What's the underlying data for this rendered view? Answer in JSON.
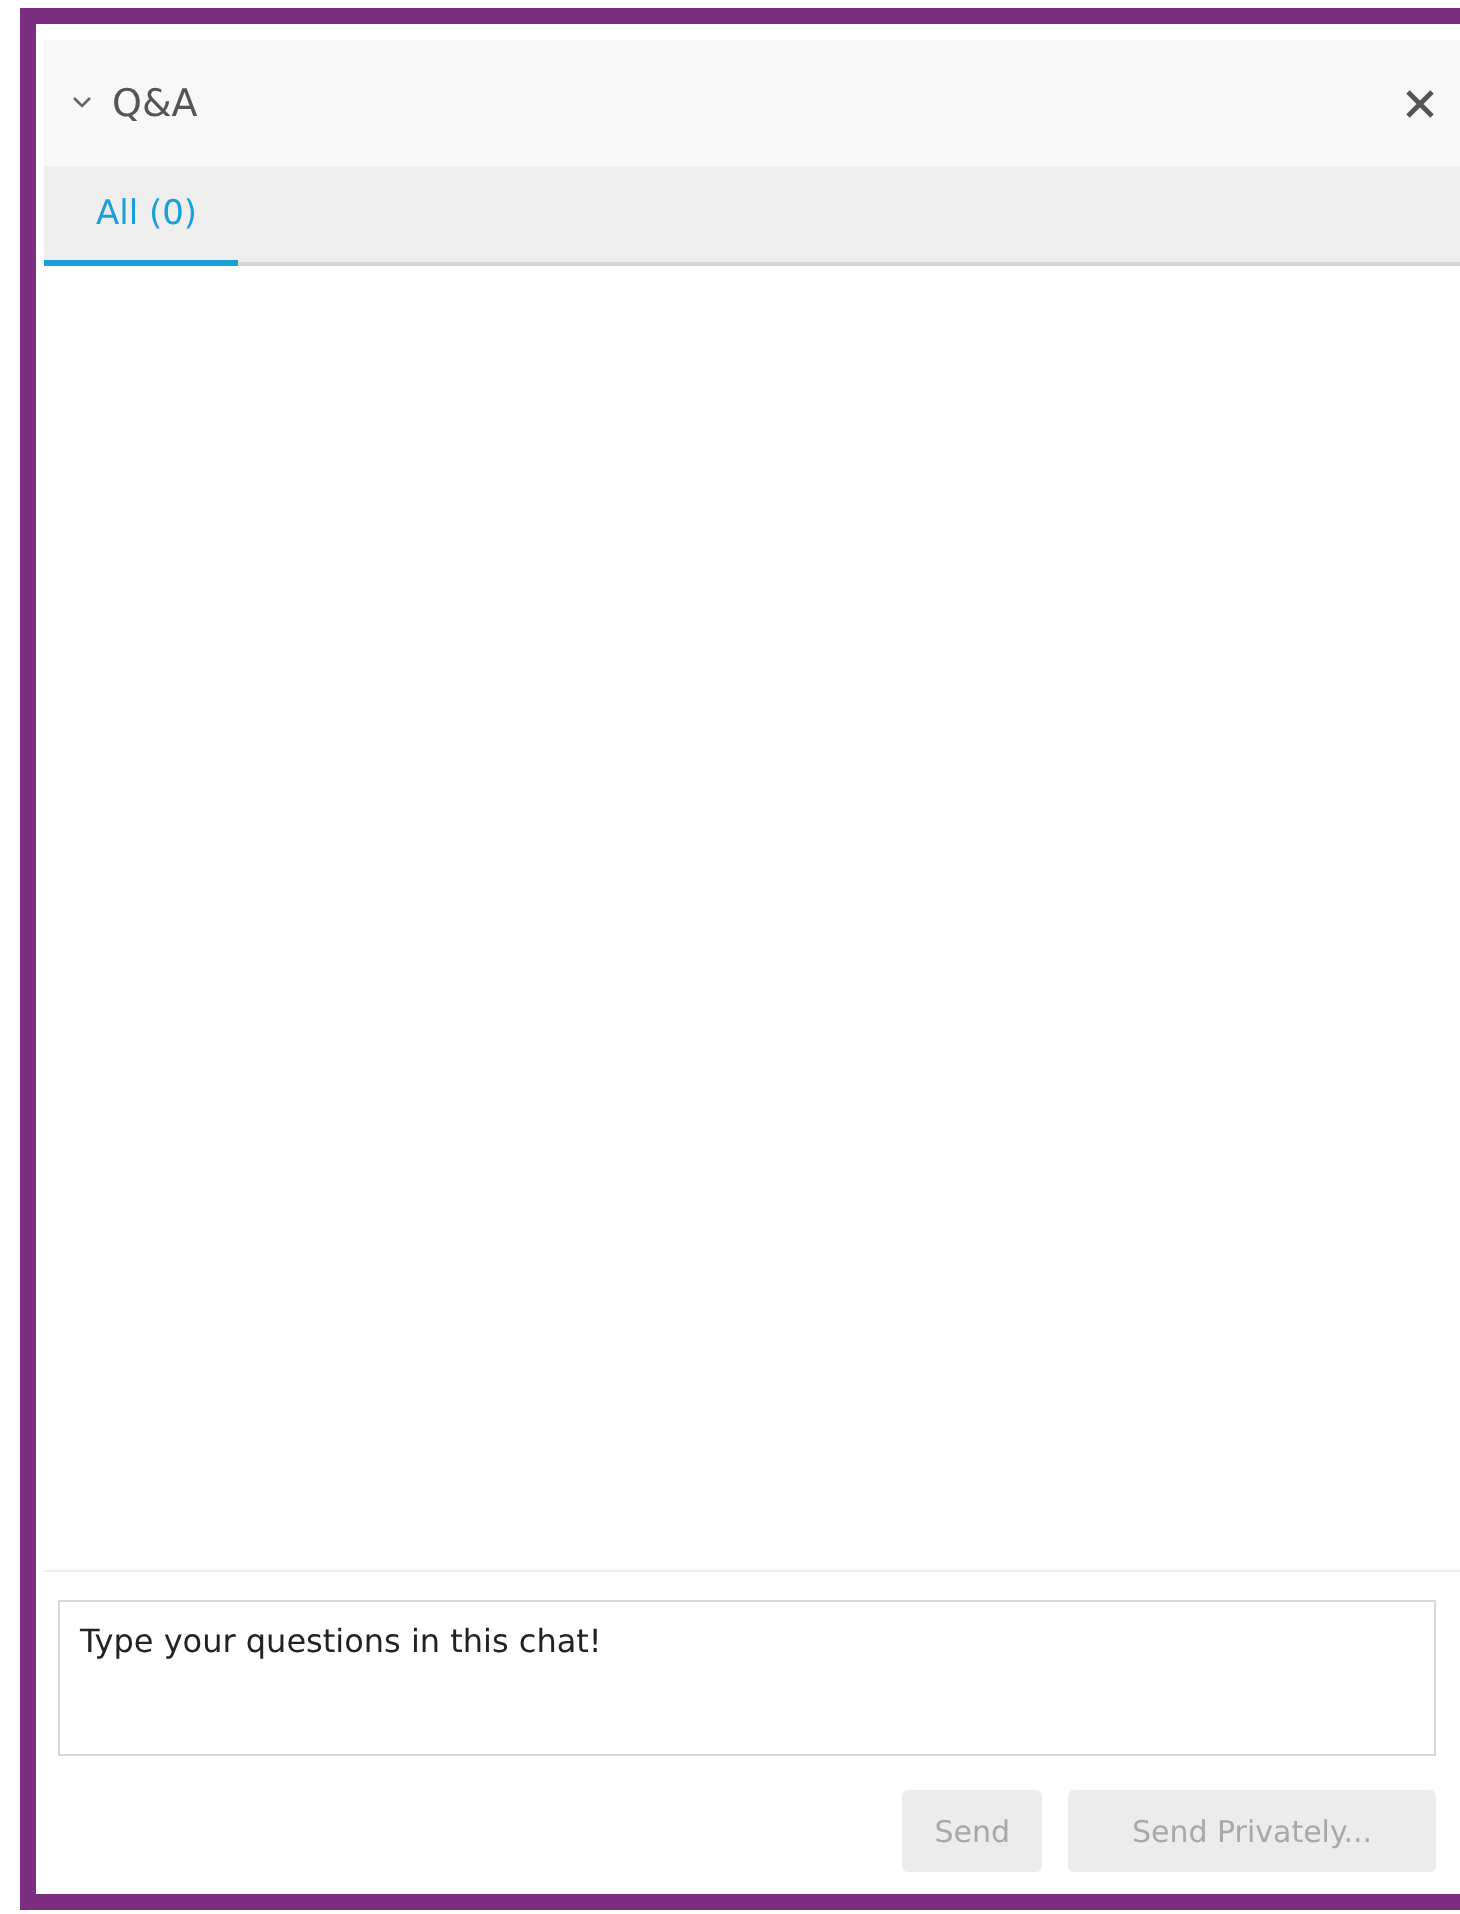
{
  "panel": {
    "title": "Q&A",
    "expanded": true
  },
  "tabs": [
    {
      "label": "All (0)",
      "selected": true
    }
  ],
  "composer": {
    "value": "Type your questions in this chat!"
  },
  "buttons": [
    {
      "label": "Send",
      "disabled": true
    },
    {
      "label": "Send Privately...",
      "disabled": true
    }
  ]
}
